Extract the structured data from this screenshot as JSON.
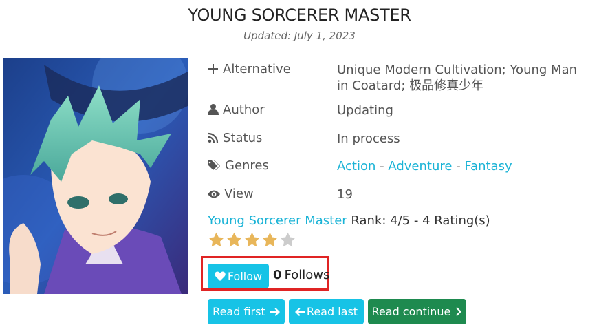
{
  "title": "YOUNG SORCERER MASTER",
  "updated": "Updated: July 1, 2023",
  "info": {
    "alternative": {
      "label": "Alternative",
      "value": "Unique Modern Cultivation; Young Man in Coatard; 极品修真少年"
    },
    "author": {
      "label": "Author",
      "value": "Updating"
    },
    "status": {
      "label": "Status",
      "value": "In process"
    },
    "genres": {
      "label": "Genres",
      "items": [
        "Action",
        "Adventure",
        "Fantasy"
      ],
      "separator": "-"
    },
    "view": {
      "label": "View",
      "value": "19"
    }
  },
  "rating": {
    "novel_link": "Young Sorcerer Master",
    "text": "Rank: 4/5 - 4 Rating(s)",
    "stars_filled": 4,
    "stars_total": 5,
    "star_color": "#e8b65a",
    "star_empty_color": "#cccccc"
  },
  "follow": {
    "button_label": "Follow",
    "count": "0",
    "count_label": "Follows"
  },
  "buttons": {
    "read_first": "Read first",
    "read_last": "Read last",
    "read_continue": "Read continue"
  },
  "colors": {
    "accent": "#17c3e6",
    "link": "#1ab3d6",
    "continue": "#1e8a4f",
    "highlight_border": "#e02424"
  }
}
